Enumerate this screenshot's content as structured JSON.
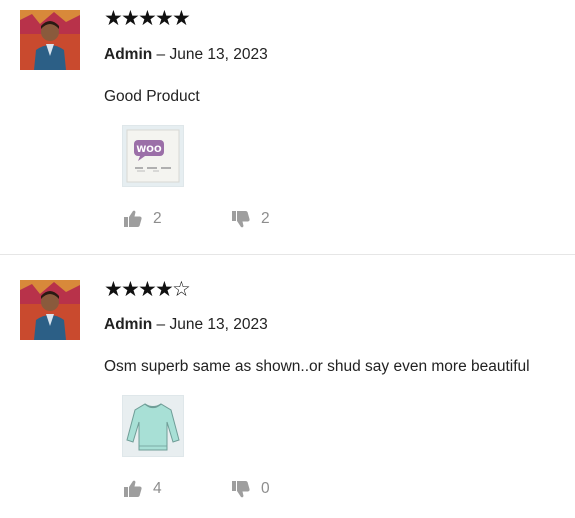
{
  "reviews": [
    {
      "stars": [
        "★",
        "★",
        "★",
        "★",
        "★"
      ],
      "rating": 5,
      "author": "Admin",
      "date_sep": " – ",
      "date": "June 13, 2023",
      "text": "Good Product",
      "attachment_icon": "woocommerce-box-icon",
      "helpful_count": "2",
      "unhelpful_count": "2"
    },
    {
      "stars": [
        "★",
        "★",
        "★",
        "★",
        "☆"
      ],
      "rating": 4,
      "author": "Admin",
      "date_sep": " – ",
      "date": "June 13, 2023",
      "text": "Osm superb same as shown..or shud say even more beautiful",
      "attachment_icon": "sweater-icon",
      "helpful_count": "4",
      "unhelpful_count": "0"
    }
  ],
  "colors": {
    "vote_icon": "#9e9e9e",
    "divider": "#e6e6e6",
    "thumb_bg": "#e6eef1"
  }
}
